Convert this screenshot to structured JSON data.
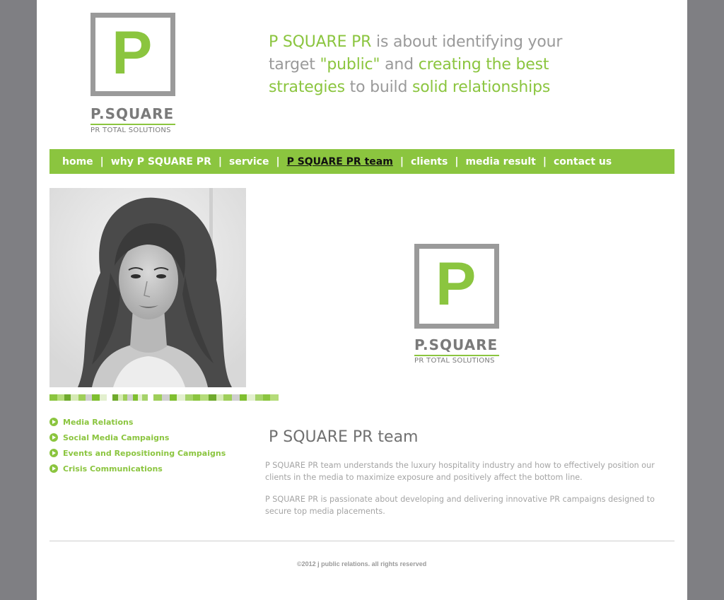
{
  "brand": {
    "logo_letter": "P",
    "logo_name": "P.SQUARE",
    "logo_subtitle": "PR TOTAL SOLUTIONS",
    "colors": {
      "green": "#8bc53f",
      "gray": "#9a9a9a",
      "frame": "#7f7f83"
    }
  },
  "tagline": {
    "parts": [
      {
        "text": "P SQUARE PR",
        "accent": true
      },
      {
        "text": " is about identifying your target ",
        "accent": false
      },
      {
        "text": "\"public\"",
        "accent": true
      },
      {
        "text": " and ",
        "accent": false
      },
      {
        "text": "creating the best strategies",
        "accent": true
      },
      {
        "text": " to build ",
        "accent": false
      },
      {
        "text": "solid relationships",
        "accent": true
      }
    ]
  },
  "nav": {
    "separator": "|",
    "items": [
      {
        "label": "home",
        "active": false
      },
      {
        "label": "why P SQUARE PR",
        "active": false
      },
      {
        "label": "service",
        "active": false
      },
      {
        "label": "P SQUARE PR team",
        "active": true
      },
      {
        "label": "clients",
        "active": false
      },
      {
        "label": "media result",
        "active": false
      },
      {
        "label": "contact us",
        "active": false
      }
    ]
  },
  "services": [
    {
      "label": "Media Relations"
    },
    {
      "label": "Social Media Campaigns"
    },
    {
      "label": "Events and Repositioning Campaigns"
    },
    {
      "label": "Crisis Communications"
    }
  ],
  "content": {
    "title": "P SQUARE PR team",
    "paragraphs": [
      "P SQUARE PR team understands the luxury hospitality industry and how to effectively position our clients in the media to maximize exposure and positively affect the bottom line.",
      "P SQUARE PR is passionate about developing and delivering innovative PR campaigns designed to secure top media placements."
    ]
  },
  "footer": {
    "text": "©2012 j public relations. all rights reserved"
  }
}
